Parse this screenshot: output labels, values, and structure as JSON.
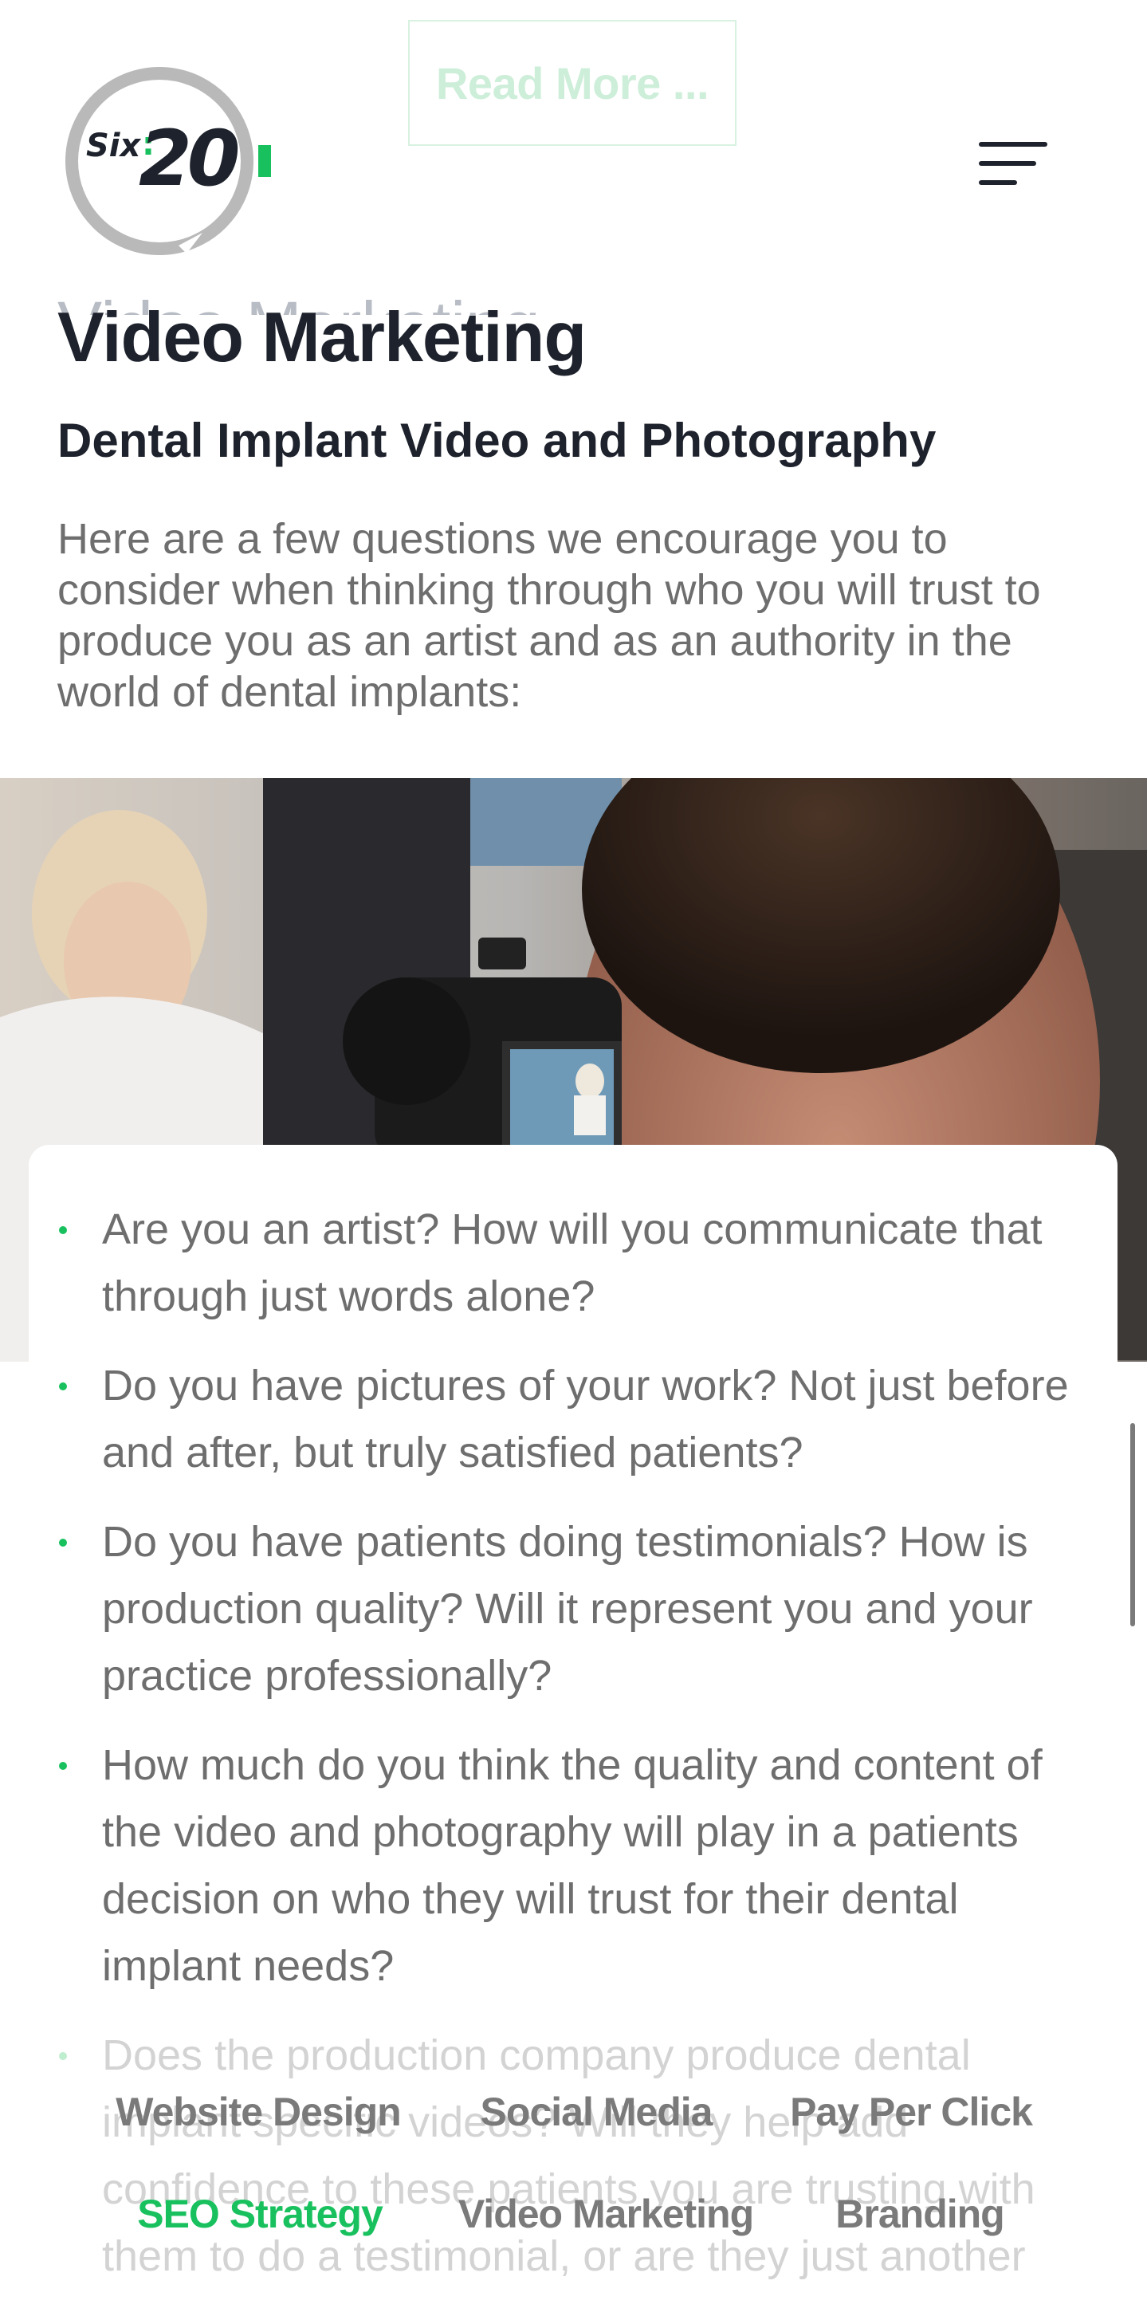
{
  "top_button": {
    "label": "Read More ..."
  },
  "logo": {
    "text_six": "Six",
    "text_colon": ":",
    "text_twenty": "20",
    "accent_color": "#19c15e"
  },
  "header": {
    "menu_icon": "hamburger-menu-icon"
  },
  "section": {
    "ghost_heading": "Video Marketing",
    "title": "Video Marketing",
    "subtitle": "Dental Implant Video and Photography",
    "intro": "Here are a few questions we encourage you to consider when thinking through who you will trust to produce you as an artist and as an authority in the world of dental implants:"
  },
  "photo": {
    "alt": "Camera filming a dental patient"
  },
  "questions": [
    "Are you an artist? How will you communicate that through just words alone?",
    "Do you have pictures of your work? Not just before and after, but truly satisfied patients?",
    "Do you have patients doing testimonials? How is production quality? Will it represent you and your practice professionally?",
    "How much do you think the quality and content of the video and photography will play in a patients decision on who they will trust for their dental implant needs?",
    "Does the production company produce dental implant specific videos? Will they help add confidence to these patients you are trusting with them to do a testimonial, or are they just another"
  ],
  "bottom_nav": {
    "row1": [
      "Website Design",
      "Social Media",
      "Pay Per Click"
    ],
    "row2": [
      "SEO Strategy",
      "Video Marketing",
      "Branding"
    ],
    "active": "SEO Strategy"
  },
  "colors": {
    "accent": "#19c15e",
    "text_dark": "#1d222c",
    "text_body": "#6e6e6e"
  }
}
